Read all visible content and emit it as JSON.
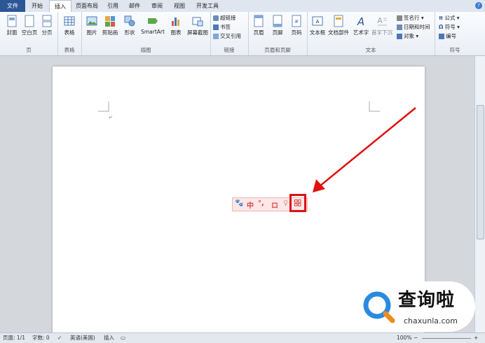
{
  "tabs": [
    "文件",
    "开始",
    "插入",
    "页面布局",
    "引用",
    "邮件",
    "审阅",
    "视图",
    "开发工具"
  ],
  "ribbon": {
    "page_group": {
      "label": "页",
      "items": [
        "封面",
        "空白页",
        "分页"
      ]
    },
    "table_group": {
      "label": "表格",
      "items": [
        "表格"
      ]
    },
    "illus_group": {
      "label": "插图",
      "items": [
        "图片",
        "剪贴画",
        "形状",
        "SmartArt",
        "图表",
        "屏幕截图"
      ]
    },
    "link_group": {
      "label": "链接",
      "items": [
        "超链接",
        "书签",
        "交叉引用"
      ]
    },
    "hf_group": {
      "label": "页眉和页脚",
      "items": [
        "页眉",
        "页脚",
        "页码"
      ]
    },
    "text_group": {
      "label": "文本",
      "items": [
        "文本框",
        "文档部件",
        "艺术字",
        "首字下沉"
      ],
      "small": [
        "签名行",
        "日期和时间",
        "对象"
      ]
    },
    "symbol_group": {
      "label": "符号",
      "items": [
        "公式",
        "符号",
        "编号"
      ]
    }
  },
  "status": {
    "page": "页面: 1/1",
    "words": "字数: 0",
    "lang": "英语(美国)",
    "mode": "插入",
    "zoom": "100%"
  },
  "ime": {
    "items": [
      "中",
      "°,",
      "ロ"
    ]
  },
  "logo": {
    "text": "查询啦",
    "url": "chaxunla.com"
  },
  "colors": {
    "file_tab": "#2b5797",
    "arrow": "#e01010",
    "ime_bg": "#fde7e7"
  }
}
